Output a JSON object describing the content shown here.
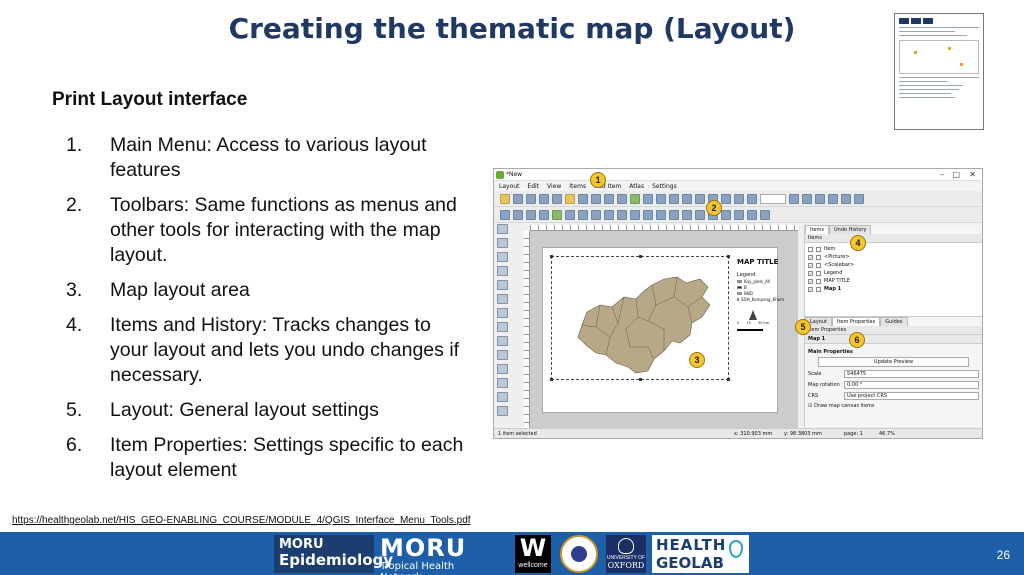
{
  "slide": {
    "title": "Creating the thematic map (Layout)",
    "subheading": "Print Layout interface",
    "steps": [
      {
        "num": "1.",
        "text": "Main Menu: Access to various layout features"
      },
      {
        "num": "2.",
        "text": "Toolbars: Same functions as menus and other tools for interacting with the map layout."
      },
      {
        "num": "3.",
        "text": "Map layout area"
      },
      {
        "num": "4.",
        "text": "Items and History: Tracks changes to your layout and lets you undo changes if necessary."
      },
      {
        "num": "5.",
        "text": "Layout: General layout settings"
      },
      {
        "num": "6.",
        "text": "Item Properties: Settings specific to each layout element"
      }
    ],
    "source_link": "https://healthgeolab.net/HIS_GEO-ENABLING_COURSE/MODULE_4/QGIS_Interface_Menu_Tools.pdf",
    "page_number": "26"
  },
  "footer_logos": {
    "moru_epi": {
      "line1": "MORU",
      "line2": "Epidemiology"
    },
    "moru_th": {
      "line1": "MORU",
      "line2": "Tropical Health Network"
    },
    "wellcome": {
      "mark": "W",
      "text": "wellcome"
    },
    "oxford": {
      "line1": "UNIVERSITY OF",
      "line2": "OXFORD"
    },
    "geolab": {
      "line1": "HEALTH",
      "line2": "GEOLAB Hub"
    }
  },
  "qgis": {
    "window_title": "*New",
    "menu": [
      "Layout",
      "Edit",
      "View",
      "Items",
      "Add Item",
      "Atlas",
      "Settings"
    ],
    "map_title": "MAP TITLE",
    "legend_title": "Legend",
    "legend_items": [
      "Kay_plots_All",
      "B",
      "BND",
      "SDH_Kampong_Khom"
    ],
    "scale_labels": [
      "0",
      "15",
      "30 km"
    ],
    "panel_tabs_top": [
      "Items",
      "Undo History"
    ],
    "items_header": "Items",
    "items_col": "Item",
    "item_rows": [
      "<Picture>",
      "<Scalebar>",
      "Legend",
      "MAP TITLE",
      "Map 1"
    ],
    "panel_tabs_bottom": [
      "Layout",
      "Item Properties",
      "Guides"
    ],
    "props_header": "Item Properties",
    "selected_item": "Map 1",
    "main_props": "Main Properties",
    "update_preview": "Update Preview",
    "scale_label": "Scale",
    "scale_value": "546475",
    "rotation_label": "Map rotation",
    "rotation_value": "0.00 °",
    "crs_label": "CRS",
    "crs_value": "Use project CRS",
    "draw_canvas": "Draw map canvas items",
    "status_selected": "1 item selected",
    "status_x": "x: 310.903 mm",
    "status_y": "y: 98.3803 mm",
    "status_page": "page: 1",
    "status_zoom": "46.7%"
  },
  "markers": [
    "1",
    "2",
    "3",
    "4",
    "5",
    "6"
  ],
  "colors": {
    "title": "#1f3864",
    "footer": "#1f5fa8",
    "marker": "#f6c42b",
    "map_fill": "#b7a888"
  }
}
